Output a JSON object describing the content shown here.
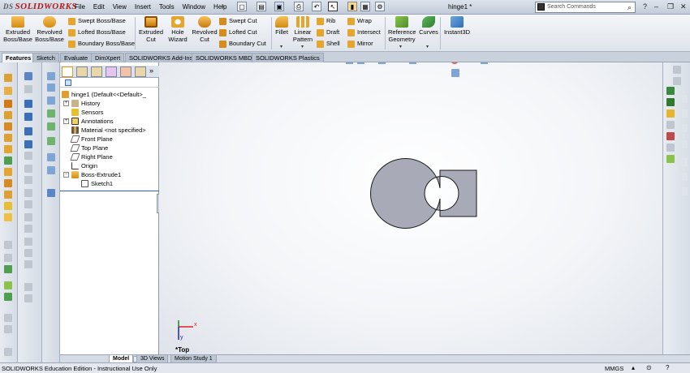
{
  "app": {
    "logo": "SOLIDWORKS",
    "logo_prefix": "DS",
    "doc_title": "hinge1 *"
  },
  "menu": [
    "File",
    "Edit",
    "View",
    "Insert",
    "Tools",
    "Window",
    "Help"
  ],
  "search": {
    "placeholder": "Search Commands"
  },
  "ribbon": {
    "extruded_boss": "Extruded Boss/Base",
    "revolved_boss": "Revolved Boss/Base",
    "swept_boss": "Swept Boss/Base",
    "lofted_boss": "Lofted Boss/Base",
    "boundary_boss": "Boundary Boss/Base",
    "extruded_cut": "Extruded Cut",
    "hole_wizard": "Hole Wizard",
    "revolved_cut": "Revolved Cut",
    "swept_cut": "Swept Cut",
    "lofted_cut": "Lofted Cut",
    "boundary_cut": "Boundary Cut",
    "fillet": "Fillet",
    "linear_pattern": "Linear Pattern",
    "rib": "Rib",
    "draft": "Draft",
    "shell": "Shell",
    "wrap": "Wrap",
    "intersect": "Intersect",
    "mirror": "Mirror",
    "reference_geometry": "Reference Geometry",
    "curves": "Curves",
    "instant3d": "Instant3D"
  },
  "cm_tabs": [
    "Features",
    "Sketch",
    "Evaluate",
    "DimXpert",
    "SOLIDWORKS Add-Ins",
    "SOLIDWORKS MBD",
    "SOLIDWORKS Plastics"
  ],
  "tree": {
    "root": "hinge1  (Default<<Default>_",
    "items": [
      "History",
      "Sensors",
      "Annotations",
      "Material <not specified>",
      "Front Plane",
      "Top Plane",
      "Right Plane",
      "Origin",
      "Boss-Extrude1",
      "Sketch1"
    ]
  },
  "view": {
    "name": "*Top",
    "axis_x": "x",
    "axis_y": "y"
  },
  "bottom_tabs": [
    "Model",
    "3D Views",
    "Motion Study 1"
  ],
  "status": {
    "text": "SOLIDWORKS Education Edition - Instructional Use Only",
    "units": "MMGS"
  },
  "colors": {
    "part_fill": "#a8aab8",
    "part_edge": "#1a1a1a",
    "accent": "#e39a1d"
  }
}
